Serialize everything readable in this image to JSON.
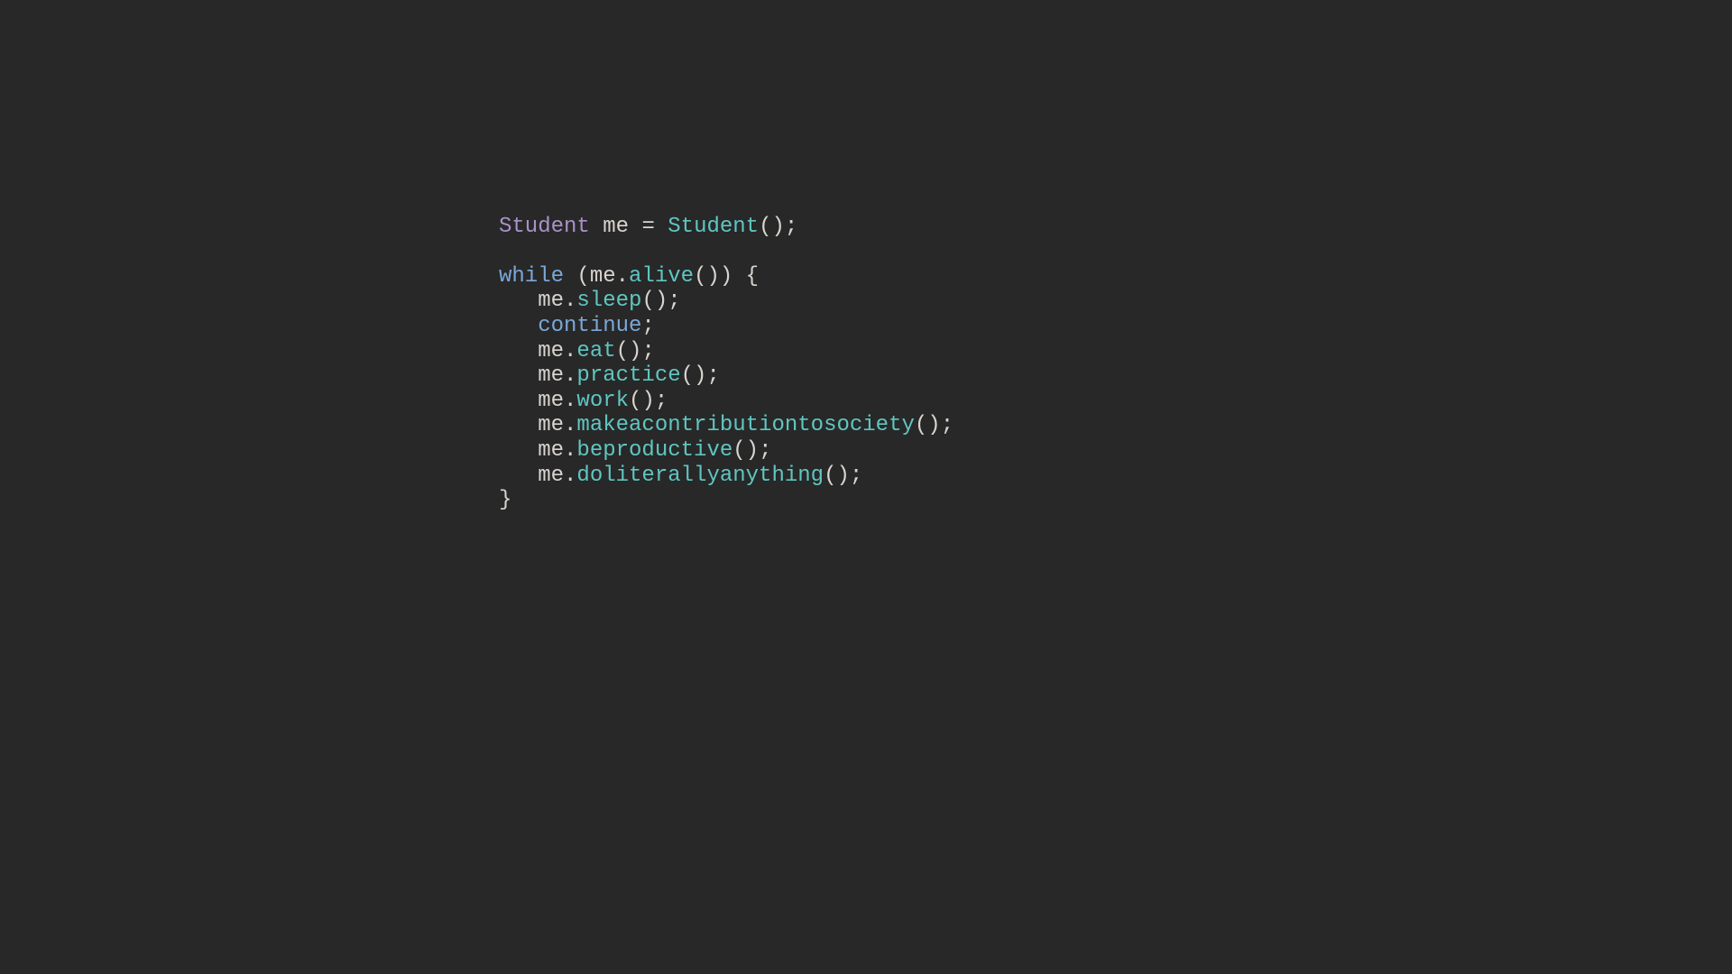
{
  "colors": {
    "background": "#282828",
    "type": "#a992c8",
    "identifier": "#d8d4cf",
    "punctuation": "#d8d4cf",
    "keyword": "#7ba7d7",
    "call": "#5fc6c1"
  },
  "code": {
    "type_student": "Student",
    "ident_me": "me",
    "op_assign": " = ",
    "ctor_student": "Student",
    "paren_open": "(",
    "paren_close": ")",
    "semicolon": ";",
    "blank": "",
    "kw_while": "while",
    "space": " ",
    "cond_open": "(",
    "cond_me": "me",
    "dot": ".",
    "call_alive": "alive",
    "cond_close_open_brace": ") {",
    "call_sleep": "sleep",
    "kw_continue": "continue",
    "call_eat": "eat",
    "call_practice": "practice",
    "call_work": "work",
    "call_makeacontributiontosociety": "makeacontributiontosociety",
    "call_beproductive": "beproductive",
    "call_doliterallyanything": "doliterallyanything",
    "close_brace": "}"
  }
}
